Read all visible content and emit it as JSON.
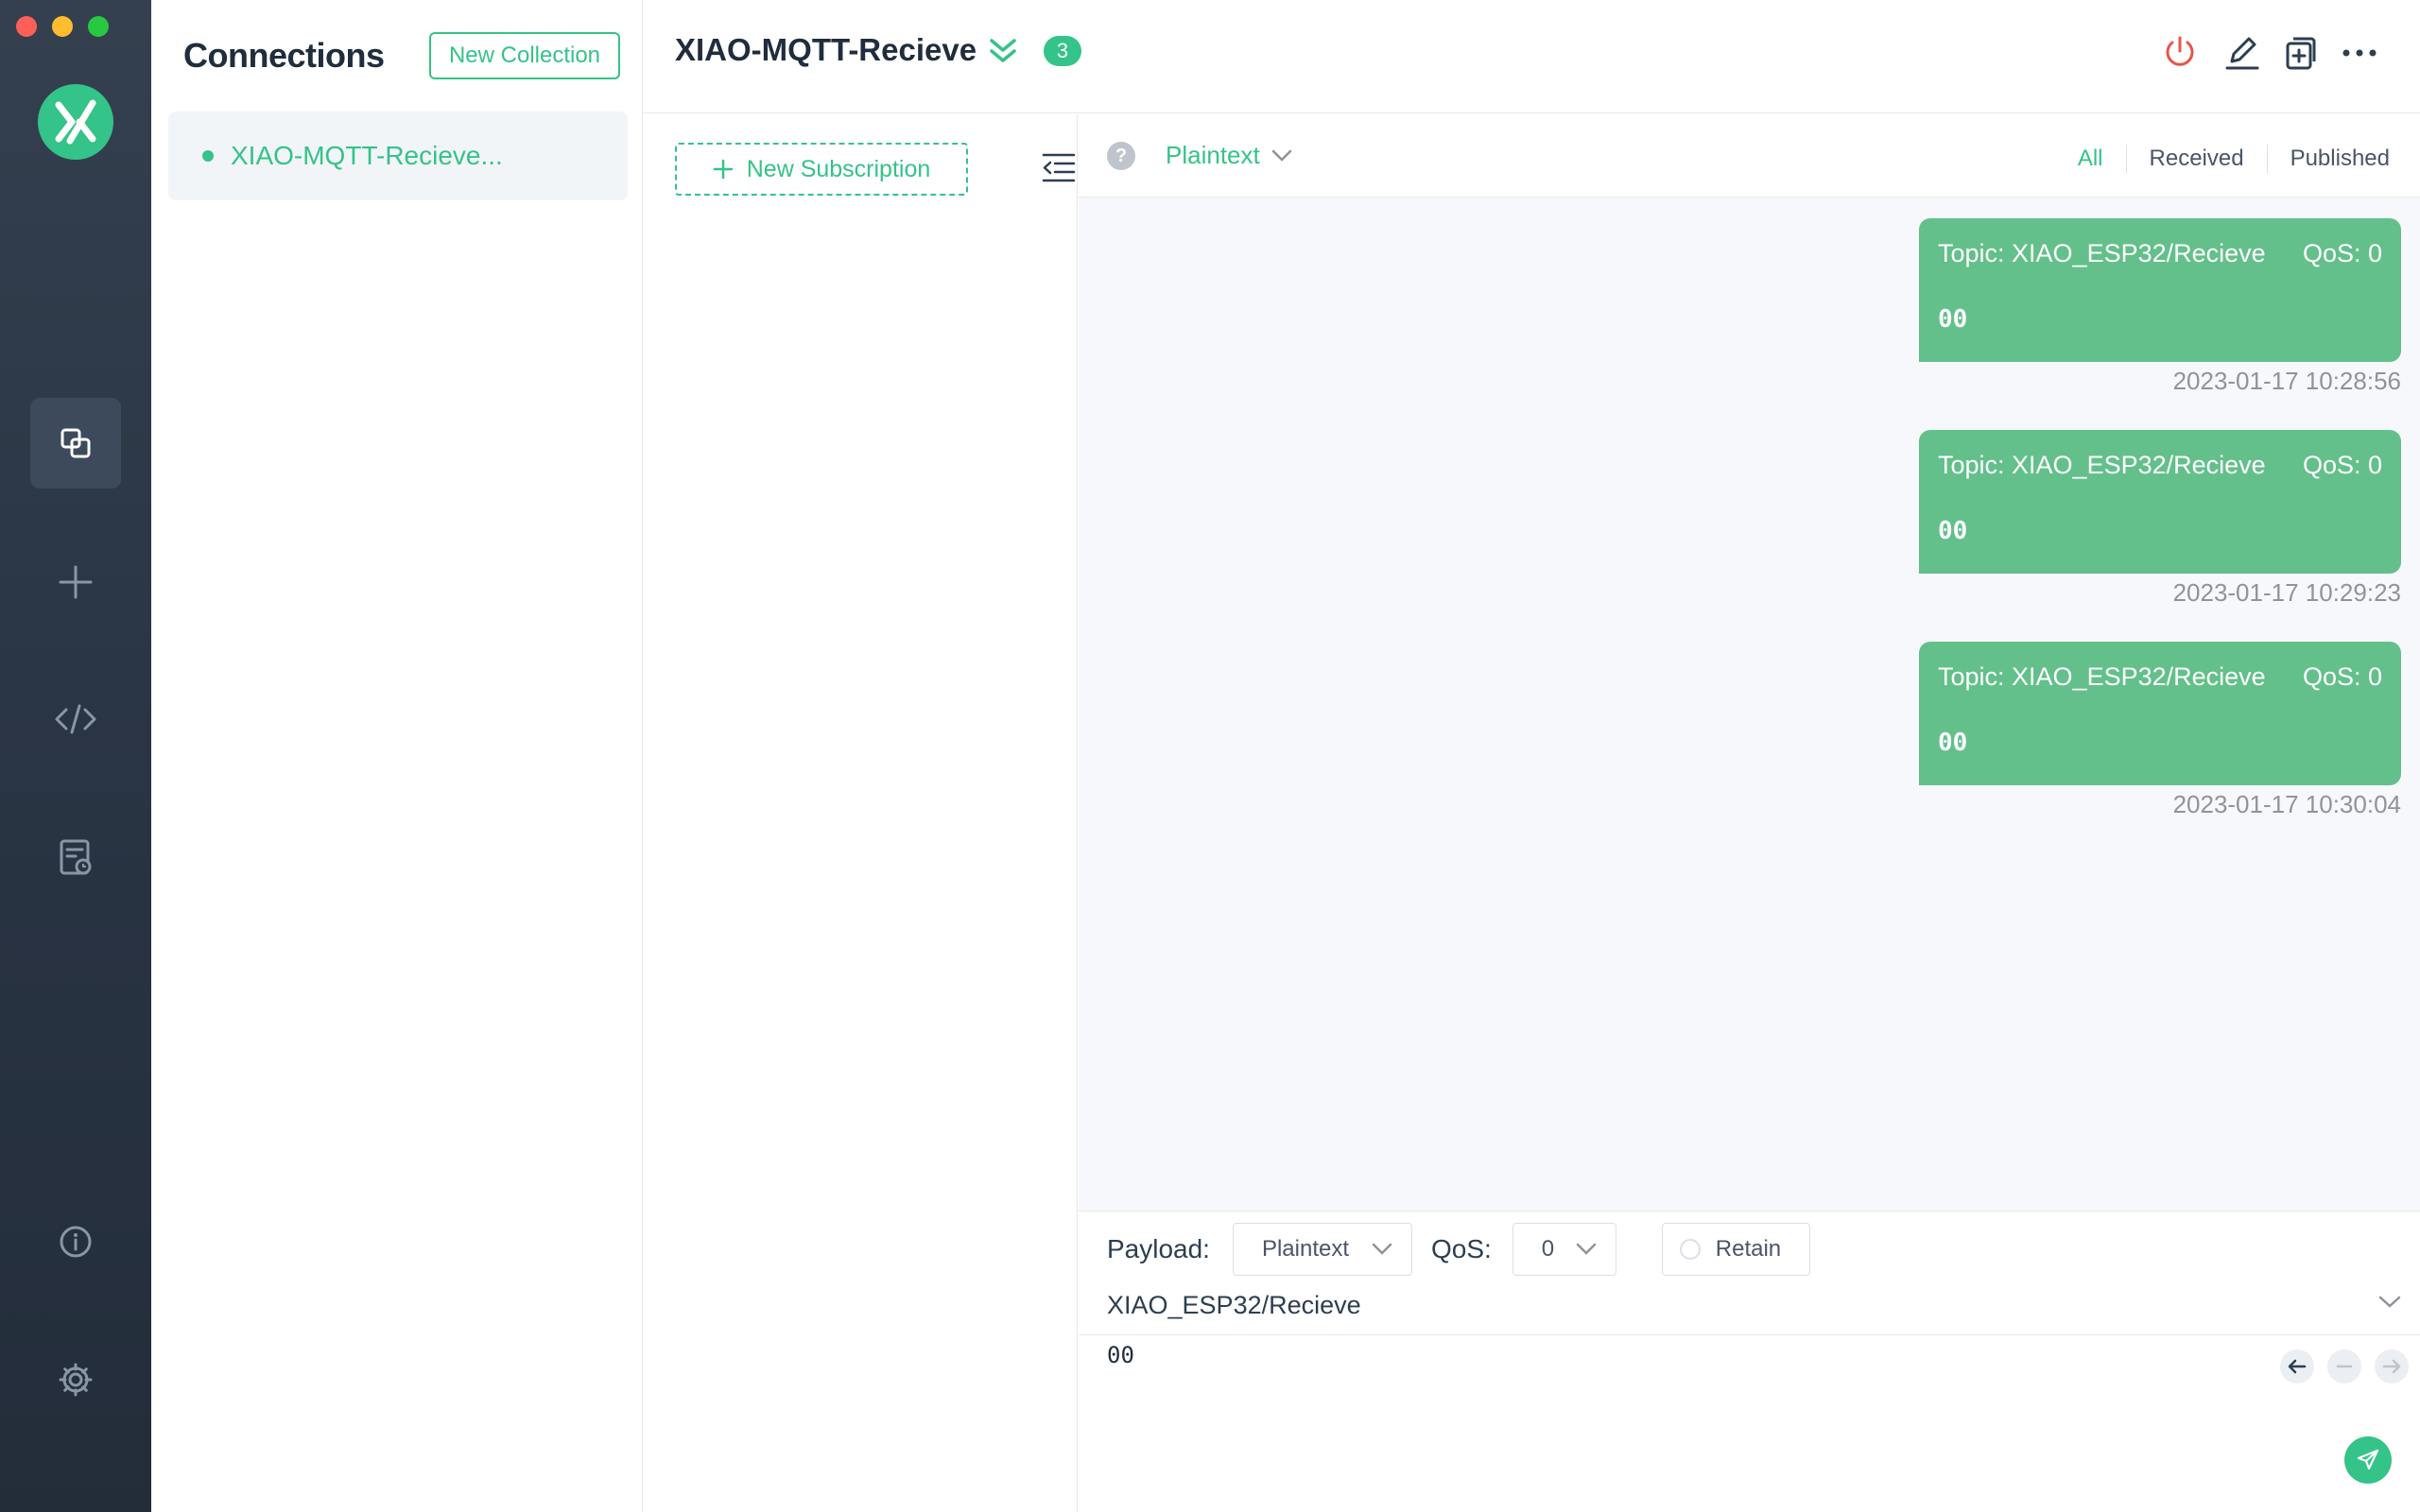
{
  "window": {
    "title": "XIAO-MQTT-Recieve"
  },
  "sidebar": {
    "items": [
      {
        "icon": "connections-icon",
        "active": true
      },
      {
        "icon": "plus-icon",
        "active": false
      },
      {
        "icon": "code-icon",
        "active": false
      },
      {
        "icon": "log-icon",
        "active": false
      },
      {
        "icon": "info-icon",
        "active": false
      },
      {
        "icon": "gear-icon",
        "active": false
      }
    ]
  },
  "connections": {
    "title": "Connections",
    "new_collection_label": "New Collection",
    "items": [
      {
        "name": "XIAO-MQTT-Recieve...",
        "status": "connected"
      }
    ]
  },
  "header": {
    "title": "XIAO-MQTT-Recieve",
    "badge_count": "3"
  },
  "subscriptions": {
    "new_subscription_label": "New Subscription"
  },
  "messages": {
    "payload_format": "Plaintext",
    "help_symbol": "?",
    "filters": [
      "All",
      "Received",
      "Published"
    ],
    "active_filter": "All",
    "list": [
      {
        "topic": "Topic: XIAO_ESP32/Recieve",
        "qos": "QoS: 0",
        "payload": "00",
        "time": "2023-01-17 10:28:56"
      },
      {
        "topic": "Topic: XIAO_ESP32/Recieve",
        "qos": "QoS: 0",
        "payload": "00",
        "time": "2023-01-17 10:29:23"
      },
      {
        "topic": "Topic: XIAO_ESP32/Recieve",
        "qos": "QoS: 0",
        "payload": "00",
        "time": "2023-01-17 10:30:04"
      }
    ]
  },
  "publish": {
    "payload_label": "Payload:",
    "payload_format": "Plaintext",
    "qos_label": "QoS:",
    "qos_value": "0",
    "retain_label": "Retain",
    "topic": "XIAO_ESP32/Recieve",
    "payload": "00"
  },
  "colors": {
    "accent": "#34c388",
    "bubble": "#63c08b",
    "rail": "#2a3545",
    "disconnect": "#e4574a"
  }
}
